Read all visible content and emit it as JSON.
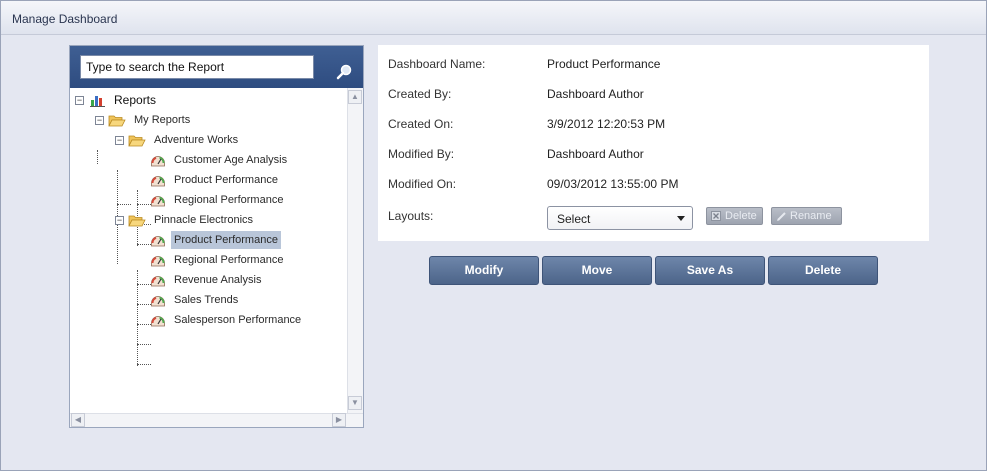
{
  "window": {
    "title": "Manage Dashboard"
  },
  "search": {
    "placeholder": "Type to search the Report",
    "value": "Type to search the Report"
  },
  "tree": {
    "root": "Reports",
    "my_reports": "My Reports",
    "folders": [
      {
        "name": "Adventure Works",
        "reports": [
          "Customer Age Analysis",
          "Product Performance",
          "Regional Performance"
        ]
      },
      {
        "name": "Pinnacle Electronics",
        "reports": [
          "Product Performance",
          "Regional Performance",
          "Revenue Analysis",
          "Sales Trends",
          "Salesperson Performance"
        ]
      }
    ],
    "selected": "Pinnacle Electronics / Product Performance"
  },
  "details": {
    "dashboard_name_label": "Dashboard Name:",
    "dashboard_name": "Product Performance",
    "created_by_label": "Created By:",
    "created_by": "Dashboard Author",
    "created_on_label": "Created On:",
    "created_on": "3/9/2012 12:20:53 PM",
    "modified_by_label": "Modified By:",
    "modified_by": "Dashboard Author",
    "modified_on_label": "Modified On:",
    "modified_on": "09/03/2012 13:55:00 PM",
    "layouts_label": "Layouts:",
    "layouts_selected": "Select",
    "layout_delete": "Delete",
    "layout_rename": "Rename"
  },
  "actions": {
    "modify": "Modify",
    "move": "Move",
    "save_as": "Save As",
    "delete": "Delete"
  },
  "colors": {
    "header_blue": "#2e4c80",
    "button_blue": "#5a7297",
    "selection": "#b9c6d9",
    "disabled_button": "#a9aeb8"
  }
}
